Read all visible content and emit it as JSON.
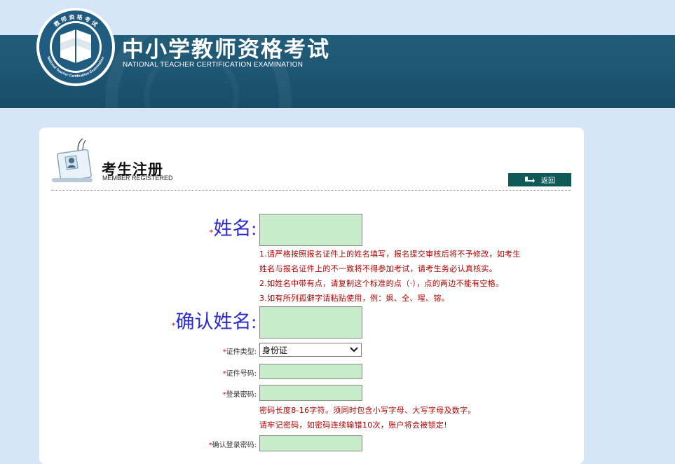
{
  "header": {
    "title": "中小学教师资格考试",
    "subtitle": "NATIONAL TEACHER CERTIFICATION EXAMINATION",
    "logo_ring_text": "教 师 资 格 考 试",
    "logo_ring_text_en": "National Teacher Certification Examination"
  },
  "panel": {
    "title": "考生注册",
    "subtitle": "MEMBER REGISTERED",
    "back_label": "返回"
  },
  "form": {
    "required_mark": "*",
    "name_label": "姓名:",
    "name_value": "",
    "name_hints": [
      "1.请严格按照报名证件上的姓名填写，报名提交审核后将不予修改，如考生",
      "姓名与报名证件上的不一致将不得参加考试，请考生务必认真核实。",
      "2.如姓名中带有点，请复制这个标准的点（·），点的两边不能有空格。",
      "3.如有所列孤僻字请粘贴使用，例：㚯、仝、瑆、镕。"
    ],
    "confirm_name_label": "确认姓名:",
    "confirm_name_value": "",
    "id_type_label": "证件类型:",
    "id_type_selected": "身份证",
    "id_number_label": "证件号码:",
    "id_number_value": "",
    "password_label": "登录密码:",
    "password_value": "",
    "password_hints": [
      "密码长度8-16字符。须同时包含小写字母、大写字母及数字。",
      "请牢记密码，如密码连续输错10次，账户将会被锁定!"
    ],
    "confirm_password_label": "确认登录密码:",
    "confirm_password_value": ""
  },
  "colors": {
    "header_band": "#1d5672",
    "page_bg": "#d6e6f7",
    "input_bg": "#c6ecca",
    "hint_text": "#b00000",
    "big_label": "#2a2acc",
    "back_button": "#0f5a59"
  },
  "icons": {
    "logo": "book-emblem-icon",
    "register": "id-badge-icon",
    "back": "return-arrow-icon",
    "select": "chevron-down-icon"
  }
}
